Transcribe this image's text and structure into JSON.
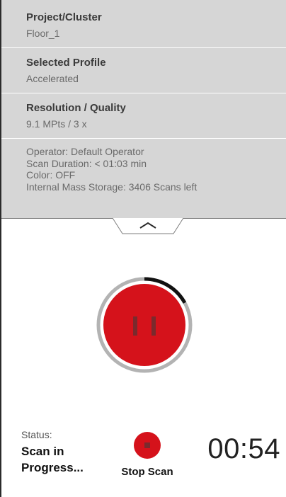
{
  "info": {
    "project_title": "Project/Cluster",
    "project_value": "Floor_1",
    "profile_title": "Selected Profile",
    "profile_value": "Accelerated",
    "resolution_title": "Resolution / Quality",
    "resolution_value": "9.1 MPts / 3 x",
    "details": [
      "Operator: Default Operator",
      "Scan Duration: < 01:03 min",
      "Color: OFF",
      "Internal Mass Storage: 3406 Scans left"
    ]
  },
  "scan": {
    "progress_fraction": 0.17,
    "status_label": "Status:",
    "status_value": "Scan in Progress...",
    "stop_label": "Stop Scan",
    "elapsed_time": "00:54"
  },
  "icons": {
    "collapse": "chevron-up-icon",
    "pause": "pause-icon",
    "stop": "stop-icon"
  },
  "colors": {
    "accent_red": "#d5121b",
    "panel_gray": "#d6d6d6",
    "ring_gray": "#b3b3b3",
    "progress_black": "#111111"
  }
}
